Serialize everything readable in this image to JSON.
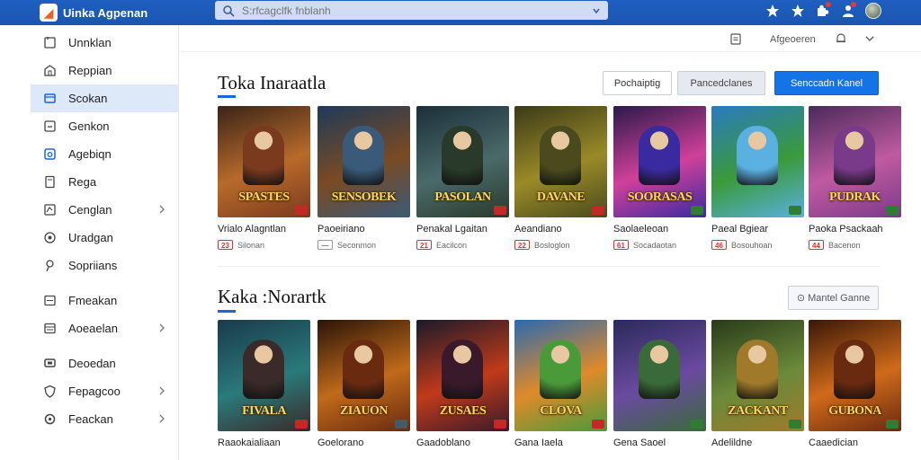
{
  "app": {
    "name": "Uinka Agpenan",
    "logo_glyph": "◢"
  },
  "search": {
    "placeholder": "S:rfcagclfk fnblanh"
  },
  "sidebar": {
    "items": [
      {
        "label": "Unnklan",
        "icon": "home-icon",
        "chevron": false
      },
      {
        "label": "Reppian",
        "icon": "store-icon",
        "chevron": false
      },
      {
        "label": "Scokan",
        "icon": "library-icon",
        "chevron": false,
        "active": true
      },
      {
        "label": "Genkon",
        "icon": "download-icon",
        "chevron": false
      },
      {
        "label": "Agebiqn",
        "icon": "friends-icon",
        "chevron": false
      },
      {
        "label": "Rega",
        "icon": "wishlist-icon",
        "chevron": false
      },
      {
        "label": "Cenglan",
        "icon": "controller-icon",
        "chevron": true
      },
      {
        "label": "Uradgan",
        "icon": "disc-icon",
        "chevron": false
      },
      {
        "label": "Sopriians",
        "icon": "pin-icon",
        "chevron": false
      },
      {
        "label": "Fmeakan",
        "icon": "chat-icon",
        "chevron": false,
        "gap_before": true
      },
      {
        "label": "Aoeaelan",
        "icon": "window-icon",
        "chevron": true
      },
      {
        "label": "Deoedan",
        "icon": "monitor-icon",
        "chevron": false,
        "gap_before": true
      },
      {
        "label": "Fepagcoo",
        "icon": "shield-icon",
        "chevron": true
      },
      {
        "label": "Feackan",
        "icon": "gear-icon",
        "chevron": true
      }
    ]
  },
  "subbar": {
    "text": "Afgeoeren"
  },
  "section1": {
    "title": "Toka Inaraatla",
    "buttons": {
      "filter": "Pochaiptig",
      "sort": "Pancedclanes",
      "primary": "Senccadn Kanel"
    }
  },
  "section2": {
    "title": "Kaka :Norartk",
    "view_all": "⊙ Mantel Ganne"
  },
  "games_row1": [
    {
      "name": "Vrialo Alagntlan",
      "cover_title": "SPASTES",
      "age": "23",
      "meta": "Silonan",
      "grey": false
    },
    {
      "name": "Paoeiriano",
      "cover_title": "SENSOBEK",
      "age": "—",
      "meta": "Seconmon",
      "grey": true
    },
    {
      "name": "Penakal Lgaitan",
      "cover_title": "PASOLAN",
      "age": "21",
      "meta": "Eacilcon",
      "grey": false
    },
    {
      "name": "Aeandiano",
      "cover_title": "DAVANE",
      "age": "22",
      "meta": "Bosloglon",
      "grey": false
    },
    {
      "name": "Saolaeleoan",
      "cover_title": "SOORASAS",
      "age": "61",
      "meta": "Socadaotan",
      "grey": false
    },
    {
      "name": "Paeal Bgiear",
      "cover_title": "",
      "age": "46",
      "meta": "Bosouhoan",
      "grey": false
    },
    {
      "name": "Paoka Psackaah",
      "cover_title": "PUDRAK",
      "age": "44",
      "meta": "Bacenon",
      "grey": false
    }
  ],
  "games_row2": [
    {
      "name": "Raaokaialiaan",
      "cover_title": "FIVALA"
    },
    {
      "name": "Goelorano",
      "cover_title": "ZIAUON"
    },
    {
      "name": "Gaadoblano",
      "cover_title": "ZUSAES"
    },
    {
      "name": "Gana Iaela",
      "cover_title": "CLOVA"
    },
    {
      "name": "Gena Saoel",
      "cover_title": ""
    },
    {
      "name": "Adelildne",
      "cover_title": "ZACKANT"
    },
    {
      "name": "Caaedician",
      "cover_title": "GUBONA"
    }
  ],
  "colors": {
    "topbar": "#1a55b0",
    "accent": "#1473e6",
    "active_bg": "#dde8f8"
  }
}
